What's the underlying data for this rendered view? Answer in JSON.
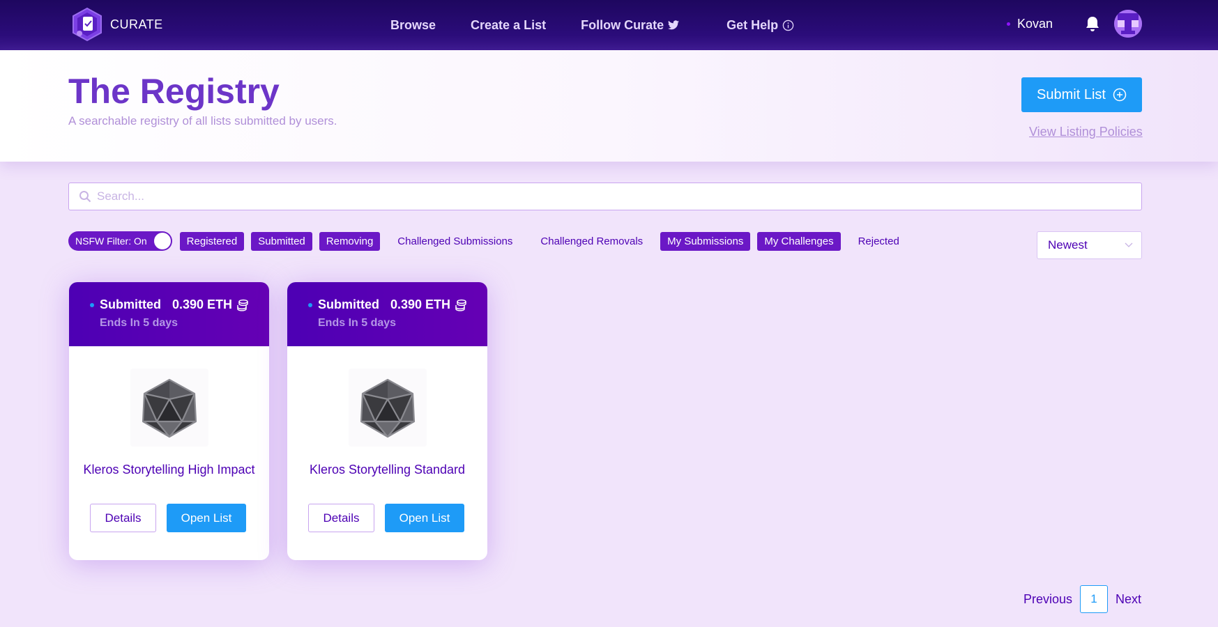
{
  "nav": {
    "logo_text": "CURATE",
    "links": [
      {
        "label": "Browse"
      },
      {
        "label": "Create a List"
      },
      {
        "label": "Follow Curate"
      },
      {
        "label": "Get Help"
      }
    ],
    "network": "Kovan"
  },
  "header": {
    "title": "The Registry",
    "subtitle": "A searchable registry of all lists submitted by users.",
    "submit_label": "Submit List",
    "policies_label": "View Listing Policies"
  },
  "search": {
    "placeholder": "Search...",
    "value": ""
  },
  "filters": {
    "nsfw_label": "NSFW Filter: On",
    "tags": [
      {
        "label": "Registered",
        "active": true
      },
      {
        "label": "Submitted",
        "active": true
      },
      {
        "label": "Removing",
        "active": true
      },
      {
        "label": "Challenged Submissions",
        "active": false
      },
      {
        "label": "Challenged Removals",
        "active": false
      },
      {
        "label": "My Submissions",
        "active": true
      },
      {
        "label": "My Challenges",
        "active": true
      },
      {
        "label": "Rejected",
        "active": false
      }
    ]
  },
  "sort": {
    "selected": "Newest"
  },
  "cards": [
    {
      "status": "Submitted",
      "deposit": "0.390 ETH",
      "ends": "Ends In 5 days",
      "title": "Kleros Storytelling High Impact",
      "details_label": "Details",
      "open_label": "Open List"
    },
    {
      "status": "Submitted",
      "deposit": "0.390 ETH",
      "ends": "Ends In 5 days",
      "title": "Kleros Storytelling Standard",
      "details_label": "Details",
      "open_label": "Open List"
    }
  ],
  "pagination": {
    "prev_label": "Previous",
    "current_page": "1",
    "next_label": "Next"
  },
  "colors": {
    "primary": "#4d00b4",
    "accent_blue": "#1e9bf7",
    "tag_active": "#6b18c6",
    "background": "#f1e4fb"
  }
}
